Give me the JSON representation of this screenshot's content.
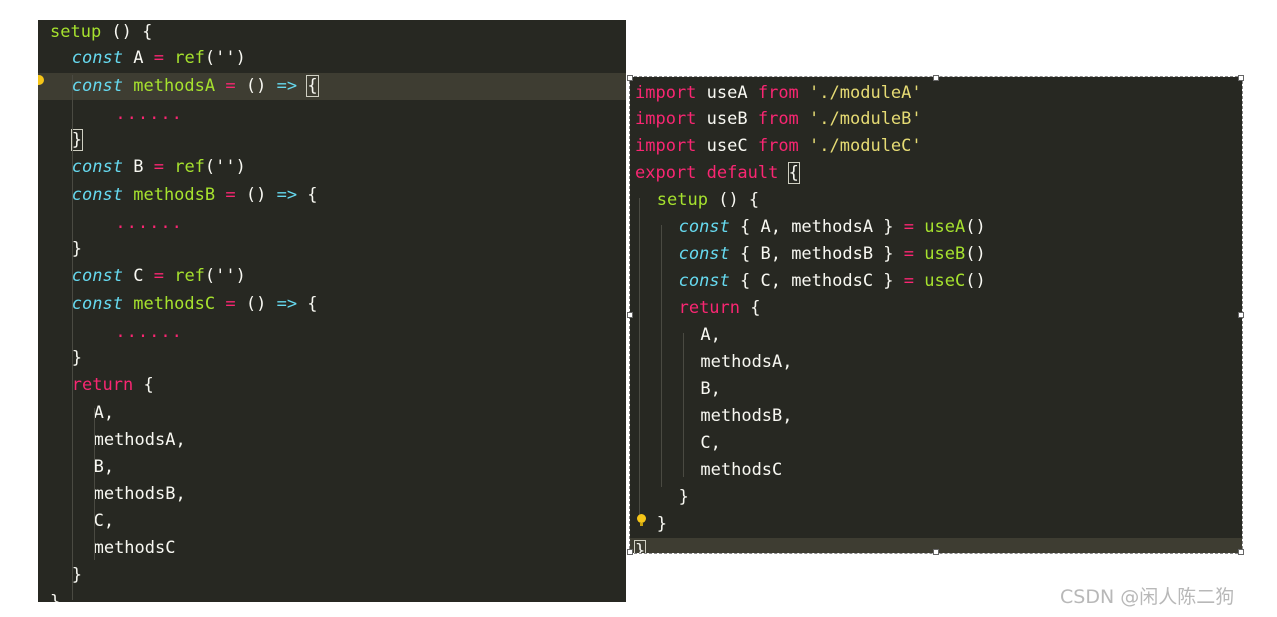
{
  "left_editor": {
    "lines": [
      [
        {
          "t": "setup",
          "c": "fn"
        },
        {
          "t": " () {",
          "c": "plain"
        }
      ],
      [
        {
          "t": "const",
          "c": "kw-i"
        },
        {
          "t": " A ",
          "c": "plain"
        },
        {
          "t": "=",
          "c": "op"
        },
        {
          "t": " ",
          "c": "plain"
        },
        {
          "t": "ref",
          "c": "fn"
        },
        {
          "t": "(''",
          "c": "plain"
        },
        {
          "t": ")",
          "c": "plain"
        }
      ],
      [
        {
          "t": "const",
          "c": "kw-i"
        },
        {
          "t": " ",
          "c": "plain"
        },
        {
          "t": "methodsA",
          "c": "fn"
        },
        {
          "t": " ",
          "c": "plain"
        },
        {
          "t": "=",
          "c": "op"
        },
        {
          "t": " () ",
          "c": "plain"
        },
        {
          "t": "=>",
          "c": "arrow"
        },
        {
          "t": " ",
          "c": "plain"
        },
        {
          "t": "{",
          "c": "cursor"
        }
      ],
      [
        {
          "t": "......",
          "c": "dots"
        }
      ],
      [
        {
          "t": "}",
          "c": "cursor"
        }
      ],
      [
        {
          "t": "const",
          "c": "kw-i"
        },
        {
          "t": " B ",
          "c": "plain"
        },
        {
          "t": "=",
          "c": "op"
        },
        {
          "t": " ",
          "c": "plain"
        },
        {
          "t": "ref",
          "c": "fn"
        },
        {
          "t": "('')",
          "c": "plain"
        }
      ],
      [
        {
          "t": "const",
          "c": "kw-i"
        },
        {
          "t": " ",
          "c": "plain"
        },
        {
          "t": "methodsB",
          "c": "fn"
        },
        {
          "t": " ",
          "c": "plain"
        },
        {
          "t": "=",
          "c": "op"
        },
        {
          "t": " () ",
          "c": "plain"
        },
        {
          "t": "=>",
          "c": "arrow"
        },
        {
          "t": " {",
          "c": "plain"
        }
      ],
      [
        {
          "t": "......",
          "c": "dots"
        }
      ],
      [
        {
          "t": "}",
          "c": "plain"
        }
      ],
      [
        {
          "t": "const",
          "c": "kw-i"
        },
        {
          "t": " C ",
          "c": "plain"
        },
        {
          "t": "=",
          "c": "op"
        },
        {
          "t": " ",
          "c": "plain"
        },
        {
          "t": "ref",
          "c": "fn"
        },
        {
          "t": "('')",
          "c": "plain"
        }
      ],
      [
        {
          "t": "const",
          "c": "kw-i"
        },
        {
          "t": " ",
          "c": "plain"
        },
        {
          "t": "methodsC",
          "c": "fn"
        },
        {
          "t": " ",
          "c": "plain"
        },
        {
          "t": "=",
          "c": "op"
        },
        {
          "t": " () ",
          "c": "plain"
        },
        {
          "t": "=>",
          "c": "arrow"
        },
        {
          "t": " {",
          "c": "plain"
        }
      ],
      [
        {
          "t": "......",
          "c": "dots"
        }
      ],
      [
        {
          "t": "}",
          "c": "plain"
        }
      ],
      [
        {
          "t": "return",
          "c": "kw-r"
        },
        {
          "t": " {",
          "c": "plain"
        }
      ],
      [
        {
          "t": "A,",
          "c": "plain"
        }
      ],
      [
        {
          "t": "methodsA,",
          "c": "plain"
        }
      ],
      [
        {
          "t": "B,",
          "c": "plain"
        }
      ],
      [
        {
          "t": "methodsB,",
          "c": "plain"
        }
      ],
      [
        {
          "t": "C,",
          "c": "plain"
        }
      ],
      [
        {
          "t": "methodsC",
          "c": "plain"
        }
      ],
      [
        {
          "t": "}",
          "c": "plain"
        }
      ],
      [
        {
          "t": "}",
          "c": "plain"
        }
      ]
    ]
  },
  "right_editor": {
    "lines": [
      [
        {
          "t": "import",
          "c": "kw-r"
        },
        {
          "t": " useA ",
          "c": "plain"
        },
        {
          "t": "from",
          "c": "kw-r"
        },
        {
          "t": " ",
          "c": "plain"
        },
        {
          "t": "'./moduleA'",
          "c": "str"
        }
      ],
      [
        {
          "t": "import",
          "c": "kw-r"
        },
        {
          "t": " useB ",
          "c": "plain"
        },
        {
          "t": "from",
          "c": "kw-r"
        },
        {
          "t": " ",
          "c": "plain"
        },
        {
          "t": "'./moduleB'",
          "c": "str"
        }
      ],
      [
        {
          "t": "import",
          "c": "kw-r"
        },
        {
          "t": " useC ",
          "c": "plain"
        },
        {
          "t": "from",
          "c": "kw-r"
        },
        {
          "t": " ",
          "c": "plain"
        },
        {
          "t": "'./moduleC'",
          "c": "str"
        }
      ],
      [
        {
          "t": "export",
          "c": "kw-r"
        },
        {
          "t": " ",
          "c": "plain"
        },
        {
          "t": "default",
          "c": "kw-r"
        },
        {
          "t": " ",
          "c": "plain"
        },
        {
          "t": "{",
          "c": "cursor"
        }
      ],
      [
        {
          "t": "setup",
          "c": "fn"
        },
        {
          "t": " () {",
          "c": "plain"
        }
      ],
      [
        {
          "t": "const",
          "c": "kw-i"
        },
        {
          "t": " { A, methodsA } ",
          "c": "plain"
        },
        {
          "t": "=",
          "c": "op"
        },
        {
          "t": " ",
          "c": "plain"
        },
        {
          "t": "useA",
          "c": "fn"
        },
        {
          "t": "()",
          "c": "plain"
        }
      ],
      [
        {
          "t": "const",
          "c": "kw-i"
        },
        {
          "t": " { B, methodsB } ",
          "c": "plain"
        },
        {
          "t": "=",
          "c": "op"
        },
        {
          "t": " ",
          "c": "plain"
        },
        {
          "t": "useB",
          "c": "fn"
        },
        {
          "t": "()",
          "c": "plain"
        }
      ],
      [
        {
          "t": "const",
          "c": "kw-i"
        },
        {
          "t": " { C, methodsC } ",
          "c": "plain"
        },
        {
          "t": "=",
          "c": "op"
        },
        {
          "t": " ",
          "c": "plain"
        },
        {
          "t": "useC",
          "c": "fn"
        },
        {
          "t": "()",
          "c": "plain"
        }
      ],
      [
        {
          "t": "return",
          "c": "kw-r"
        },
        {
          "t": " {",
          "c": "plain"
        }
      ],
      [
        {
          "t": "A,",
          "c": "plain"
        }
      ],
      [
        {
          "t": "methodsA,",
          "c": "plain"
        }
      ],
      [
        {
          "t": "B,",
          "c": "plain"
        }
      ],
      [
        {
          "t": "methodsB,",
          "c": "plain"
        }
      ],
      [
        {
          "t": "C,",
          "c": "plain"
        }
      ],
      [
        {
          "t": "methodsC",
          "c": "plain"
        }
      ],
      [
        {
          "t": "}",
          "c": "plain"
        }
      ],
      [
        {
          "t": "}",
          "c": "plain"
        }
      ],
      [
        {
          "t": "}",
          "c": "cursor"
        }
      ]
    ]
  },
  "watermark": "CSDN @闲人陈二狗",
  "colors": {
    "editor_bg": "#272822",
    "keyword_pink": "#f92672",
    "keyword_cyan": "#66d9ef",
    "function_green": "#a6e22e",
    "string_yellow": "#e6db74",
    "text": "#f8f8f2"
  },
  "icons": [
    "lightbulb-icon"
  ]
}
